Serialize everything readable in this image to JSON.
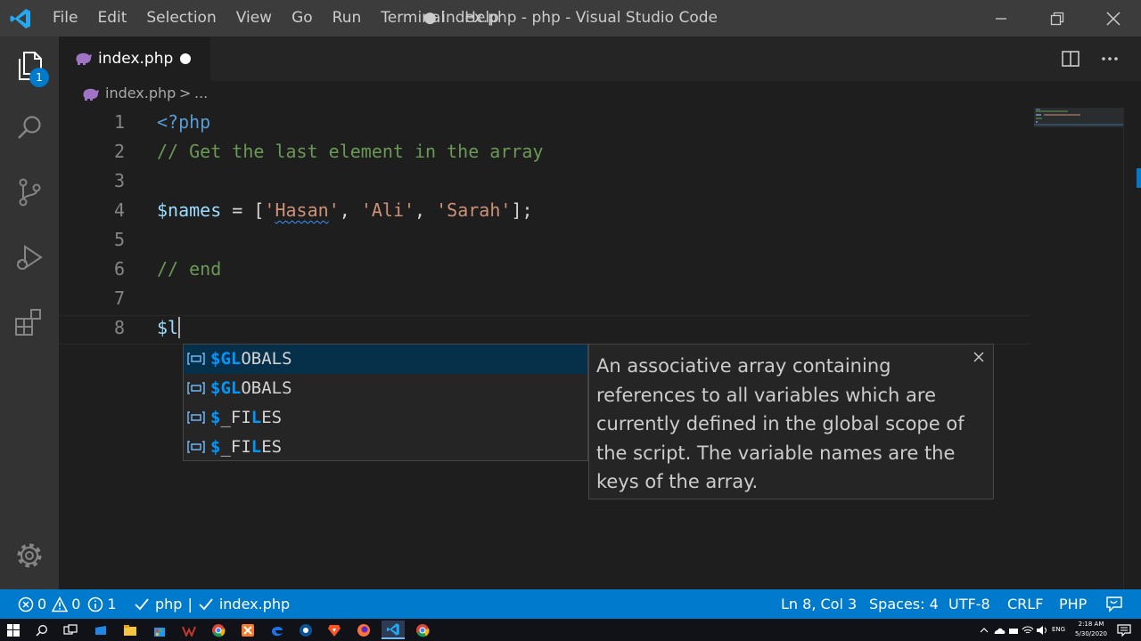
{
  "window": {
    "title": "● index.php - php - Visual Studio Code",
    "menu": [
      "File",
      "Edit",
      "Selection",
      "View",
      "Go",
      "Run",
      "Terminal",
      "Help"
    ]
  },
  "activity_bar": {
    "items": [
      "files-icon",
      "search-icon",
      "source-control-icon",
      "run-debug-icon",
      "extensions-icon"
    ],
    "explorer_badge": "1",
    "bottom": "gear-icon"
  },
  "tab": {
    "label": "index.php",
    "dirty": true
  },
  "breadcrumb": {
    "file": "index.php",
    "separator": ">",
    "more": "..."
  },
  "editor": {
    "lines": [
      {
        "num": "1",
        "parts": [
          {
            "t": "<?php",
            "c": "kw"
          }
        ]
      },
      {
        "num": "2",
        "parts": [
          {
            "t": "// Get the last element in the array",
            "c": "cm"
          }
        ]
      },
      {
        "num": "3",
        "parts": []
      },
      {
        "num": "4",
        "parts": [
          {
            "t": "$names",
            "c": "var"
          },
          {
            "t": " = [",
            "c": "op"
          },
          {
            "t": "'",
            "c": "str"
          },
          {
            "t": "Hasan",
            "c": "str squiggle"
          },
          {
            "t": "'",
            "c": "str"
          },
          {
            "t": ", ",
            "c": "op"
          },
          {
            "t": "'Ali'",
            "c": "str"
          },
          {
            "t": ", ",
            "c": "op"
          },
          {
            "t": "'Sarah'",
            "c": "str"
          },
          {
            "t": "];",
            "c": "op"
          }
        ]
      },
      {
        "num": "5",
        "parts": []
      },
      {
        "num": "6",
        "parts": [
          {
            "t": "// end",
            "c": "cm"
          }
        ]
      },
      {
        "num": "7",
        "parts": []
      },
      {
        "num": "8",
        "parts": [
          {
            "t": "$l",
            "c": "var"
          }
        ],
        "cursor": true
      }
    ]
  },
  "suggest": {
    "items": [
      {
        "pre": "$",
        "hl": "G",
        "mid1": "",
        "hl2": "L",
        "post": "OBALS",
        "selected": true
      },
      {
        "pre": "$",
        "hl": "G",
        "mid1": "",
        "hl2": "L",
        "post": "OBALS",
        "selected": false
      },
      {
        "pre": "$",
        "hl": "",
        "mid1": "_FI",
        "hl2": "L",
        "post": "ES",
        "selected": false
      },
      {
        "pre": "$",
        "hl": "",
        "mid1": "_FI",
        "hl2": "L",
        "post": "ES",
        "selected": false
      }
    ],
    "details": "An associative array containing references to all variables which are currently defined in the global scope of the script. The variable names are the keys of the array."
  },
  "status": {
    "errors": "0",
    "warnings": "0",
    "info": "1",
    "php_check": "php",
    "sep": "|",
    "file_check": "index.php",
    "position": "Ln 8, Col 3",
    "spaces": "Spaces: 4",
    "encoding": "UTF-8",
    "eol": "CRLF",
    "language": "PHP"
  },
  "taskbar": {
    "apps": [
      "windows-start-icon",
      "search-icon",
      "task-view-icon",
      "store-icon",
      "file-explorer-icon",
      "shop-bag-icon",
      "winamp-icon",
      "chrome-icon",
      "xampp-icon",
      "edge-icon",
      "app-icon",
      "brave-icon",
      "firefox-icon",
      "vscode-icon",
      "chrome-icon"
    ],
    "lang": "ENG",
    "time": "2:18 AM",
    "date": "5/30/2020"
  },
  "colors": {
    "accent": "#007acc",
    "keyword": "#569cd6",
    "comment": "#6a9955",
    "variable": "#9cdcfe",
    "string": "#ce9178"
  }
}
